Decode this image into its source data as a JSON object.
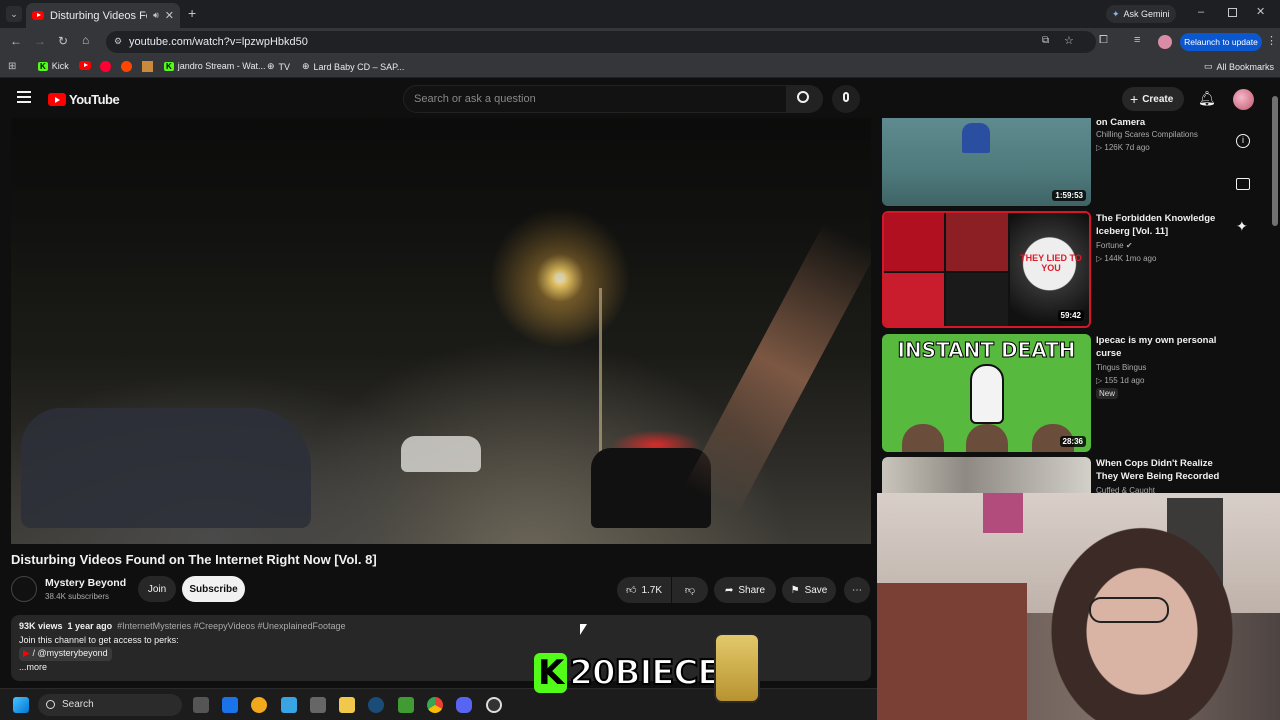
{
  "browser": {
    "tab_title": "Disturbing Videos Found o",
    "url": "youtube.com/watch?v=lpzwpHbkd50",
    "ask_gemini": "Ask Gemini",
    "relaunch": "Relaunch to update",
    "bookmarks": [
      "Kick",
      "jandro Stream - Wat...",
      "TV",
      "Lard Baby CD – SAP..."
    ],
    "all_bookmarks": "All Bookmarks"
  },
  "youtube": {
    "logo_text": "YouTube",
    "search_placeholder": "Search or ask a question",
    "create_label": "Create"
  },
  "video": {
    "title": "Disturbing Videos Found on The Internet Right Now [Vol. 8]",
    "channel": "Mystery Beyond",
    "subscribers": "38.4K subscribers",
    "join": "Join",
    "subscribe": "Subscribe",
    "likes": "1.7K",
    "share": "Share",
    "save": "Save",
    "views": "93K views",
    "age": "1 year ago",
    "hashtags": "#InternetMysteries #CreepyVideos #UnexplainedFootage",
    "desc_line": "Join this channel to get access to perks:",
    "handle": "/ @mysterybeyond",
    "more": "...more"
  },
  "recommendations": [
    {
      "title": "on Camera",
      "channel": "Chilling Scares Compilations",
      "meta": "126K  7d ago",
      "duration": "1:59:53"
    },
    {
      "title": "The Forbidden Knowledge Iceberg [Vol. 11]",
      "channel": "Fortune",
      "meta": "144K  1mo ago",
      "duration": "59:42",
      "thumb_text": "THEY LIED TO YOU"
    },
    {
      "title": "Ipecac is my own personal curse",
      "channel": "Tingus Bingus",
      "meta": "155  1d ago",
      "badge": "New",
      "duration": "28:36",
      "thumb_text": "INSTANT DEATH"
    },
    {
      "title": "When Cops Didn't Realize They Were Being Recorded",
      "channel": "Cuffed & Caught"
    }
  ],
  "taskbar": {
    "search": "Search"
  },
  "overlay": {
    "kick_text": "20BIECE"
  },
  "colors": {
    "accent": "#ff0000",
    "kick_green": "#53fc18",
    "bg": "#0f0f0f"
  }
}
